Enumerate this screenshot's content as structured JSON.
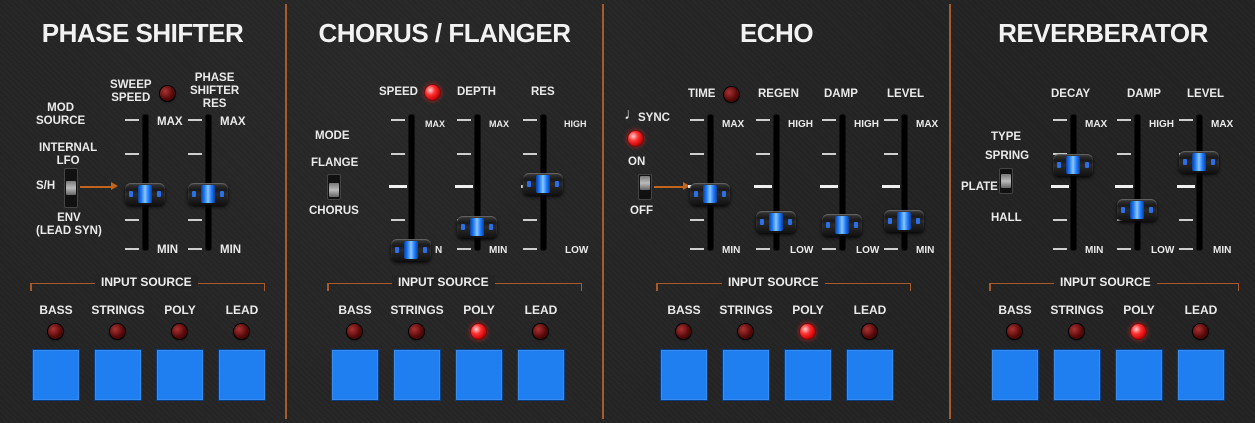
{
  "phase": {
    "title": "PHASE SHIFTER",
    "mod_source_label": "MOD\nSOURCE",
    "internal_lfo": "INTERNAL\nLFO",
    "sh": "S/H",
    "env": "ENV\n(LEAD SYN)",
    "sweep_speed": "SWEEP\nSPEED",
    "phase_res": "PHASE\nSHIFTER\nRES",
    "max": "MAX",
    "min": "MIN",
    "input_source": "INPUT SOURCE",
    "sources": [
      "BASS",
      "STRINGS",
      "POLY",
      "LEAD"
    ],
    "led_states": [
      false,
      false,
      false,
      false
    ],
    "slider_levels": {
      "sweep": 0.5,
      "res": 0.5
    }
  },
  "chorus": {
    "title": "CHORUS / FLANGER",
    "mode": "MODE",
    "flange": "FLANGE",
    "chorus": "CHORUS",
    "speed": "SPEED",
    "depth": "DEPTH",
    "res": "RES",
    "max": "MAX",
    "min": "MIN",
    "high": "HIGH",
    "low": "LOW",
    "speed_min_partial": "N",
    "input_source": "INPUT SOURCE",
    "sources": [
      "BASS",
      "STRINGS",
      "POLY",
      "LEAD"
    ],
    "led_states": [
      false,
      false,
      true,
      false
    ],
    "slider_levels": {
      "speed": 0.0,
      "depth": 0.2,
      "res": 0.58
    }
  },
  "echo": {
    "title": "ECHO",
    "sync": "SYNC",
    "note_icon": "♩",
    "on": "ON",
    "off": "OFF",
    "time": "TIME",
    "regen": "REGEN",
    "damp": "DAMP",
    "level": "LEVEL",
    "max": "MAX",
    "min": "MIN",
    "high": "HIGH",
    "low": "LOW",
    "input_source": "INPUT SOURCE",
    "sources": [
      "BASS",
      "STRINGS",
      "POLY",
      "LEAD"
    ],
    "led_states": [
      false,
      false,
      true,
      false
    ],
    "slider_levels": {
      "time": 0.5,
      "regen": 0.25,
      "damp": 0.22,
      "level": 0.26
    }
  },
  "reverb": {
    "title": "REVERBERATOR",
    "type": "TYPE",
    "spring": "SPRING",
    "plate": "PLATE",
    "hall": "HALL",
    "decay": "DECAY",
    "damp": "DAMP",
    "level": "LEVEL",
    "max": "MAX",
    "min": "MIN",
    "high": "HIGH",
    "low": "LOW",
    "input_source": "INPUT SOURCE",
    "sources": [
      "BASS",
      "STRINGS",
      "POLY",
      "LEAD"
    ],
    "led_states": [
      false,
      false,
      true,
      false
    ],
    "slider_levels": {
      "decay": 0.75,
      "damp": 0.35,
      "level": 0.78
    }
  },
  "colors": {
    "accent_orange": "#a85a2a",
    "button_blue": "#1f7ff0",
    "led_on": "#ff3030",
    "led_off": "#5a0a0a",
    "background": "#242424"
  }
}
